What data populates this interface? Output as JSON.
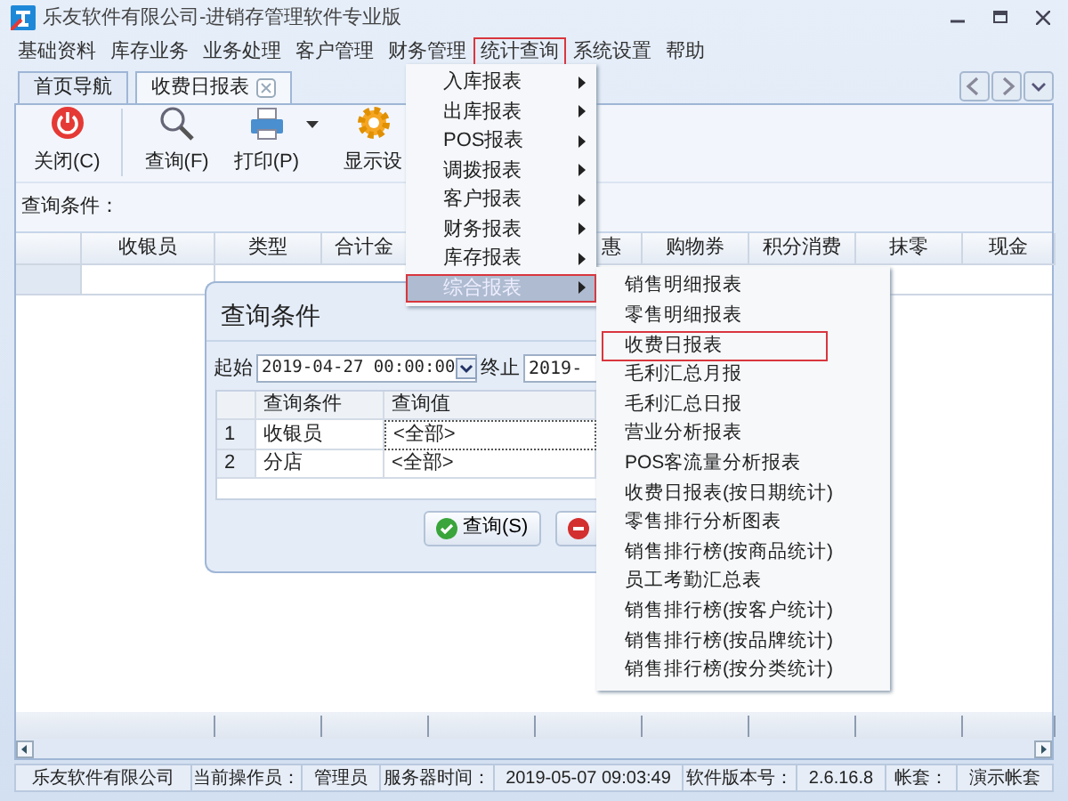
{
  "window": {
    "title": "乐友软件有限公司-进销存管理软件专业版"
  },
  "menu_bar": [
    {
      "label": "基础资料",
      "selected": false
    },
    {
      "label": "库存业务",
      "selected": false
    },
    {
      "label": "业务处理",
      "selected": false
    },
    {
      "label": "客户管理",
      "selected": false
    },
    {
      "label": "财务管理",
      "selected": false
    },
    {
      "label": "统计查询",
      "selected": true
    },
    {
      "label": "系统设置",
      "selected": false
    },
    {
      "label": "帮助",
      "selected": false
    }
  ],
  "tabs": [
    {
      "label": "首页导航",
      "selected": false,
      "closable": false
    },
    {
      "label": "收费日报表",
      "selected": true,
      "closable": true
    }
  ],
  "toolbar": [
    {
      "label": "关闭(C)",
      "kind": "power",
      "dropdown": false
    },
    {
      "label": "查询(F)",
      "kind": "search",
      "dropdown": false
    },
    {
      "label": "打印(P)",
      "kind": "print",
      "dropdown": true
    },
    {
      "label": "显示设",
      "kind": "gear",
      "dropdown": false
    }
  ],
  "query_label": "查询条件：",
  "grid": {
    "columns": [
      "收银员",
      "类型",
      "合计金",
      "惠",
      "购物券",
      "积分消费",
      "抹零",
      "现金"
    ]
  },
  "stats_menu": {
    "items": [
      {
        "label": "入库报表",
        "selected": false
      },
      {
        "label": "出库报表",
        "selected": false
      },
      {
        "label": "POS报表",
        "selected": false
      },
      {
        "label": "调拨报表",
        "selected": false
      },
      {
        "label": "客户报表",
        "selected": false
      },
      {
        "label": "财务报表",
        "selected": false
      },
      {
        "label": "库存报表",
        "selected": false
      },
      {
        "label": "综合报表",
        "selected": true
      }
    ]
  },
  "report_submenu": {
    "items": [
      {
        "label": "销售明细报表",
        "selected": false
      },
      {
        "label": "零售明细报表",
        "selected": false
      },
      {
        "label": "收费日报表",
        "selected": true
      },
      {
        "label": "毛利汇总月报",
        "selected": false
      },
      {
        "label": "毛利汇总日报",
        "selected": false
      },
      {
        "label": "营业分析报表",
        "selected": false
      },
      {
        "label": "POS客流量分析报表",
        "selected": false
      },
      {
        "label": "收费日报表(按日期统计)",
        "selected": false
      },
      {
        "label": "零售排行分析图表",
        "selected": false
      },
      {
        "label": "销售排行榜(按商品统计)",
        "selected": false
      },
      {
        "label": "员工考勤汇总表",
        "selected": false
      },
      {
        "label": "销售排行榜(按客户统计)",
        "selected": false
      },
      {
        "label": "销售排行榜(按品牌统计)",
        "selected": false
      },
      {
        "label": "销售排行榜(按分类统计)",
        "selected": false
      }
    ]
  },
  "query_dialog": {
    "title": "查询条件",
    "start_label": "起始",
    "start_value": "2019-04-27 00:00:00",
    "end_label": "终止",
    "end_value": "2019-",
    "columns": [
      "查询条件",
      "查询值"
    ],
    "rows": [
      {
        "index": "1",
        "condition": "收银员",
        "value": "<全部>",
        "selected": true
      },
      {
        "index": "2",
        "condition": "分店",
        "value": "<全部>",
        "selected": false
      }
    ],
    "buttons": [
      {
        "label": "查询(S)",
        "kind": "ok"
      },
      {
        "kind": "cancel"
      }
    ]
  },
  "status_bar": [
    "乐友软件有限公司",
    "当前操作员：",
    "管理员",
    "服务器时间：",
    "2019-05-07 09:03:49",
    "软件版本号：",
    "2.6.16.8",
    "帐套：",
    "演示帐套"
  ]
}
